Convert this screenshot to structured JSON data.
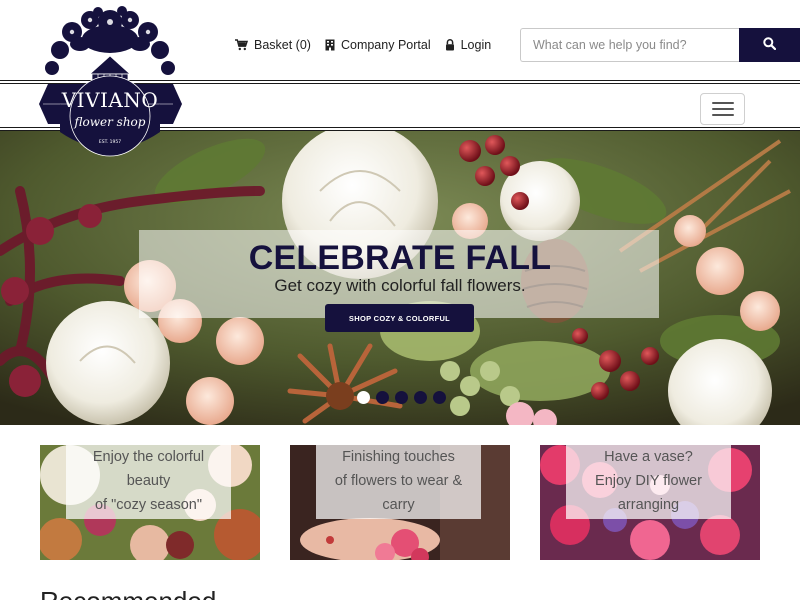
{
  "header": {
    "logo": {
      "brand": "VIVIANO",
      "tagline": "flower shop",
      "est": "EST. 1957"
    },
    "links": [
      {
        "label": "Basket (0)",
        "icon": "cart-icon"
      },
      {
        "label": "Company Portal",
        "icon": "building-icon"
      },
      {
        "label": "Login",
        "icon": "lock-icon"
      }
    ],
    "search": {
      "placeholder": "What can we help you find?",
      "value": "",
      "icon": "search-icon"
    },
    "menu_icon": "hamburger-icon"
  },
  "hero": {
    "title": "CELEBRATE FALL",
    "subtitle": "Get cozy with colorful fall flowers.",
    "button_label": "SHOP COZY & COLORFUL",
    "slide_count": 5,
    "active_slide": 1
  },
  "tiles": [
    {
      "lines": [
        "Enjoy the colorful",
        "beauty",
        "of \"cozy season\""
      ]
    },
    {
      "lines": [
        "Finishing touches",
        "of flowers to wear &",
        "carry"
      ]
    },
    {
      "lines": [
        "Have a vase?",
        "Enjoy DIY flower",
        "arranging"
      ]
    }
  ],
  "sections": {
    "recommended_heading": "Recommended"
  },
  "colors": {
    "brand_navy": "#15113d",
    "accent_active_dot": "#ffffff"
  }
}
